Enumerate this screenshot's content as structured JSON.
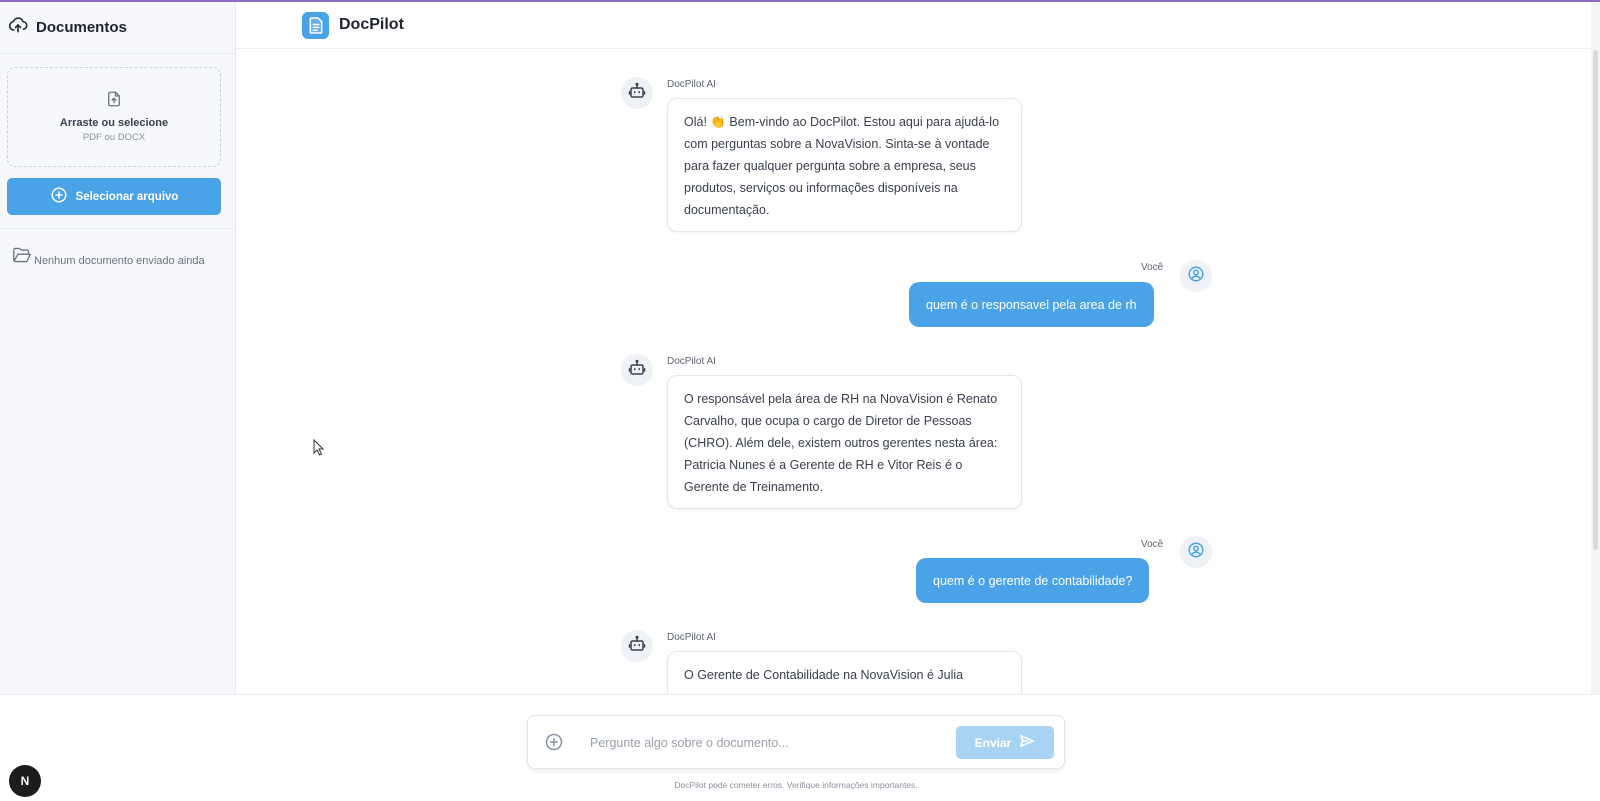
{
  "sidebar": {
    "title": "Documentos",
    "upload": {
      "title": "Arraste ou selecione",
      "subtitle": "PDF ou DOCX"
    },
    "select_button": "Selecionar arquivo",
    "empty_message": "Nenhum documento enviado ainda"
  },
  "header": {
    "brand": "DocPilot"
  },
  "messages": [
    {
      "role": "bot",
      "sender": "DocPilot AI",
      "text": "Olá! 👏 Bem-vindo ao DocPilot. Estou aqui para ajudá-lo com perguntas sobre a NovaVision. Sinta-se à vontade para fazer qualquer pergunta sobre a empresa, seus produtos, serviços ou informações disponíveis na documentação."
    },
    {
      "role": "user",
      "sender": "Você",
      "text": "quem é o responsavel pela area de rh"
    },
    {
      "role": "bot",
      "sender": "DocPilot AI",
      "text": "O responsável pela área de RH na NovaVision é Renato Carvalho, que ocupa o cargo de Diretor de Pessoas (CHRO). Além dele, existem outros gerentes nesta área: Patricia Nunes é a Gerente de RH e Vitor Reis é o Gerente de Treinamento."
    },
    {
      "role": "user",
      "sender": "Você",
      "text": "quem é o gerente de contabilidade?"
    },
    {
      "role": "bot",
      "sender": "DocPilot AI",
      "text": "O Gerente de Contabilidade na NovaVision é Julia"
    }
  ],
  "composer": {
    "placeholder": "Pergunte algo sobre o documento...",
    "send_label": "Enviar",
    "disclaimer": "DocPilot pode cometer erros. Verifique informações importantes."
  },
  "badge": "N",
  "colors": {
    "accent": "#4aa3e6",
    "accent_disabled": "#a9d3f3",
    "sidebar_bg": "#f6f8fb"
  }
}
